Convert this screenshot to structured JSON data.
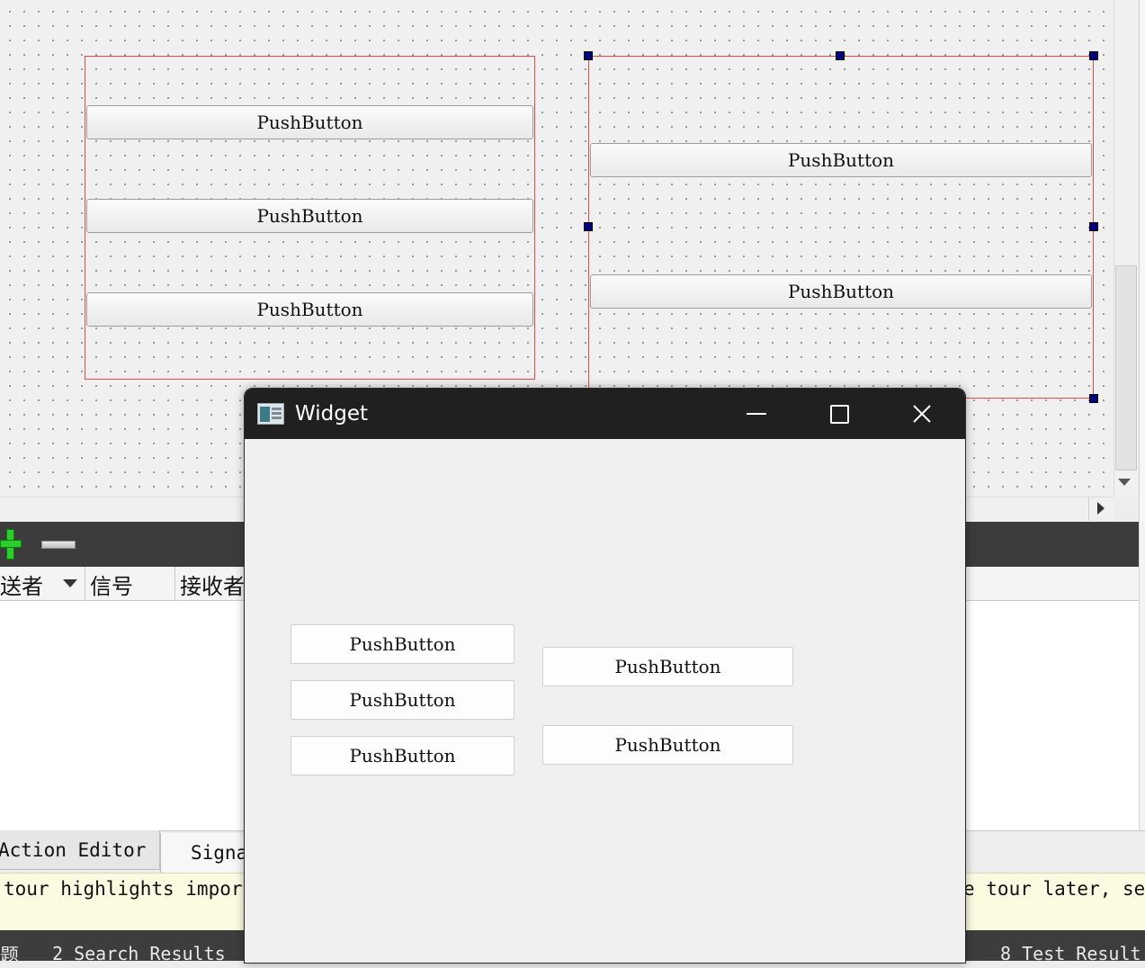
{
  "designer": {
    "left_layout_buttons": [
      "PushButton",
      "PushButton",
      "PushButton"
    ],
    "right_layout_buttons": [
      "PushButton",
      "PushButton"
    ]
  },
  "signal_slot_editor": {
    "add_icon": "plus-icon",
    "remove_icon": "minus-icon",
    "columns": [
      "送者",
      "信号",
      "接收者"
    ],
    "tabs": [
      "Action Editor",
      "Signa"
    ]
  },
  "tour_bar": {
    "left_text": "tour highlights import",
    "right_text": "e tour later, sel"
  },
  "status_bar": {
    "left_fragment": "题",
    "item_2": "2 Search Results",
    "item_8": "8 Test Result"
  },
  "preview_window": {
    "title": "Widget",
    "app_icon": "window-app-icon",
    "left_buttons": [
      "PushButton",
      "PushButton",
      "PushButton"
    ],
    "right_buttons": [
      "PushButton",
      "PushButton"
    ]
  },
  "colors": {
    "layout_border": "#e04848",
    "selection_handle": "#00007a",
    "titlebar": "#202020",
    "tour_bar": "#fbfbe2"
  }
}
